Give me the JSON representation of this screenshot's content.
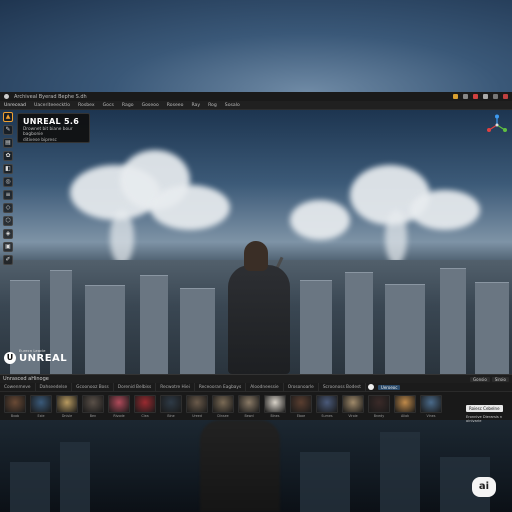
{
  "window": {
    "title": "Archiveal Byerad Bephe S.dh"
  },
  "menubar": {
    "items": [
      "Unrecead",
      "Uaceriteeecktlo",
      "Rosbex",
      "Gocs",
      "Rago",
      "Goseoo",
      "Roseeo",
      "Ray",
      "Rog",
      "Sosalo"
    ]
  },
  "viewport": {
    "tooltip": {
      "title": "UNREAL 5.6",
      "line1": "Drownet bit biane bour bagbonie",
      "line2": "ditivese bipresc"
    },
    "logo": {
      "small_text": "Eurecn Leacle",
      "brand": "UNREAL"
    }
  },
  "content_browser": {
    "title": "Unrasced aHinoge",
    "header_buttons": [
      "Gonsio",
      "Siroio"
    ],
    "tabs": [
      "Cowenmeve",
      "Dahseedelse",
      "Gcoonooz Boss",
      "Dorenid Belbiss",
      "Recwotre Hiei",
      "Receooran Eagbays",
      "Aloodneessie",
      "Orosonoarle",
      "Scroonoss Bodest"
    ],
    "tab_button": "Ueroeoc",
    "assets": [
      {
        "label": "Bxab",
        "color": "#6a4a35"
      },
      {
        "label": "Exle",
        "color": "#3a5a7a"
      },
      {
        "label": "Dnisle",
        "color": "#b89a60"
      },
      {
        "label": "Ben",
        "color": "#5a5048"
      },
      {
        "label": "Rivode",
        "color": "#b04a5a"
      },
      {
        "label": "Clea",
        "color": "#9a2a30"
      },
      {
        "label": "Bine",
        "color": "#2e3a46"
      },
      {
        "label": "Ureed",
        "color": "#6a5a4a"
      },
      {
        "label": "Dinsee",
        "color": "#7a6a55"
      },
      {
        "label": "Bewd",
        "color": "#8a7a66"
      },
      {
        "label": "Bines",
        "color": "#d8d2c8"
      },
      {
        "label": "Ebae",
        "color": "#5a3e30"
      },
      {
        "label": "Sumes",
        "color": "#4a5a7a"
      },
      {
        "label": "Viroie",
        "color": "#a08a6a"
      },
      {
        "label": "Bnedy",
        "color": "#3a2a28"
      },
      {
        "label": "Aliok",
        "color": "#c08a4a"
      },
      {
        "label": "Vines",
        "color": "#4a6a8a"
      }
    ],
    "side_panel": {
      "button": "Roiesc Cebelne",
      "text": "Eronnlve Dierarsis n  oinivarie"
    }
  },
  "badge": {
    "label": "ai"
  },
  "colors": {
    "accent": "#f0a030",
    "titlebar": "#1a1a1a",
    "panel": "#191919"
  }
}
